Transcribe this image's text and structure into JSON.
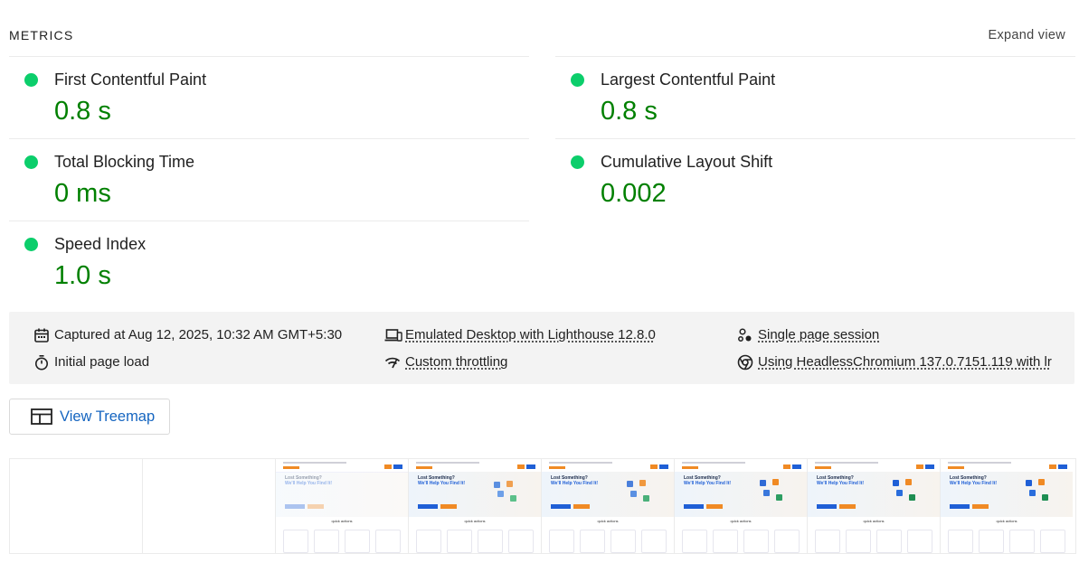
{
  "header": {
    "title": "METRICS",
    "expand_label": "Expand view"
  },
  "metrics": [
    {
      "label": "First Contentful Paint",
      "value": "0.8 s",
      "status": "pass"
    },
    {
      "label": "Largest Contentful Paint",
      "value": "0.8 s",
      "status": "pass"
    },
    {
      "label": "Total Blocking Time",
      "value": "0 ms",
      "status": "pass"
    },
    {
      "label": "Cumulative Layout Shift",
      "value": "0.002",
      "status": "pass"
    },
    {
      "label": "Speed Index",
      "value": "1.0 s",
      "status": "pass"
    }
  ],
  "colors": {
    "pass_dot": "#0cce6b",
    "pass_value": "#008000",
    "link": "#1565c0"
  },
  "runtime": {
    "captured": "Captured at Aug 12, 2025, 10:32 AM GMT+5:30",
    "page_load": "Initial page load",
    "device": "Emulated Desktop with Lighthouse 12.8.0",
    "throttling": "Custom throttling",
    "session": "Single page session",
    "browser": "Using HeadlessChromium 137.0.7151.119 with lr"
  },
  "icons": {
    "captured": "calendar-icon",
    "page_load": "stopwatch-icon",
    "device": "desktop-device-icon",
    "throttling": "network-throttle-icon",
    "session": "session-icon",
    "browser": "chrome-icon",
    "treemap": "treemap-icon"
  },
  "treemap": {
    "label": "View Treemap"
  },
  "filmstrip": {
    "frames": [
      {
        "state": "blank"
      },
      {
        "state": "blank"
      },
      {
        "state": "loading",
        "heading_line1": "Lost Something?",
        "heading_line2": "We'll Help You Find It!",
        "section": "quick actions"
      },
      {
        "state": "loaded",
        "heading_line1": "Lost Something?",
        "heading_line2": "We'll Help You Find It!",
        "section": "quick actions"
      },
      {
        "state": "loaded",
        "heading_line1": "Lost Something?",
        "heading_line2": "We'll Help You Find It!",
        "section": "quick actions"
      },
      {
        "state": "loaded",
        "heading_line1": "Lost Something?",
        "heading_line2": "We'll Help You Find It!",
        "section": "quick actions"
      },
      {
        "state": "loaded",
        "heading_line1": "Lost Something?",
        "heading_line2": "We'll Help You Find It!",
        "section": "quick actions"
      },
      {
        "state": "loaded",
        "heading_line1": "Lost Something?",
        "heading_line2": "We'll Help You Find It!",
        "section": "quick actions"
      }
    ]
  }
}
